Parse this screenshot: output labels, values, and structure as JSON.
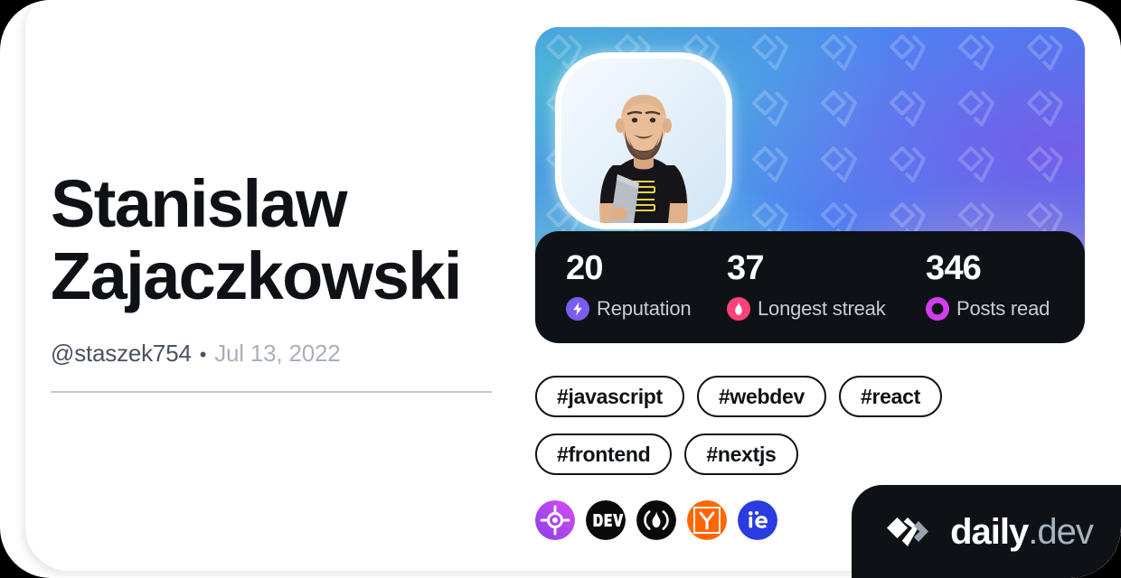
{
  "profile": {
    "display_name": "Stanislaw Zajaczkowski",
    "username": "@staszek754",
    "separator": "•",
    "joined_date": "Jul 13, 2022",
    "avatar_alt": "avatar"
  },
  "stats": [
    {
      "value": "20",
      "label": "Reputation",
      "icon": "reputation-bolt-icon",
      "color": "#7C5CEF"
    },
    {
      "value": "37",
      "label": "Longest streak",
      "icon": "streak-flame-icon",
      "color": "#FF427A"
    },
    {
      "value": "346",
      "label": "Posts read",
      "icon": "posts-read-ring-icon",
      "color": "#D33DF0"
    }
  ],
  "tags": [
    {
      "label": "#javascript"
    },
    {
      "label": "#webdev"
    },
    {
      "label": "#react"
    },
    {
      "label": "#frontend"
    },
    {
      "label": "#nextjs"
    }
  ],
  "sources": [
    {
      "name": "source-icon-target",
      "title": "target"
    },
    {
      "name": "source-icon-devto",
      "title": "DEV"
    },
    {
      "name": "source-icon-hashnode",
      "title": "flame"
    },
    {
      "name": "source-icon-hackernews",
      "title": "Y"
    },
    {
      "name": "source-icon-ie",
      "title": "ie"
    }
  ],
  "brand": {
    "name": "daily",
    "suffix": ".dev",
    "logo": "daily-dev-logo-icon"
  },
  "colors": {
    "ink": "#0E1217",
    "muted": "#4A5260",
    "faint": "#A8B0BA",
    "panel": "#0E1217",
    "reputation": "#7C5CEF",
    "streak": "#FF427A",
    "posts_read": "#D33DF0"
  }
}
